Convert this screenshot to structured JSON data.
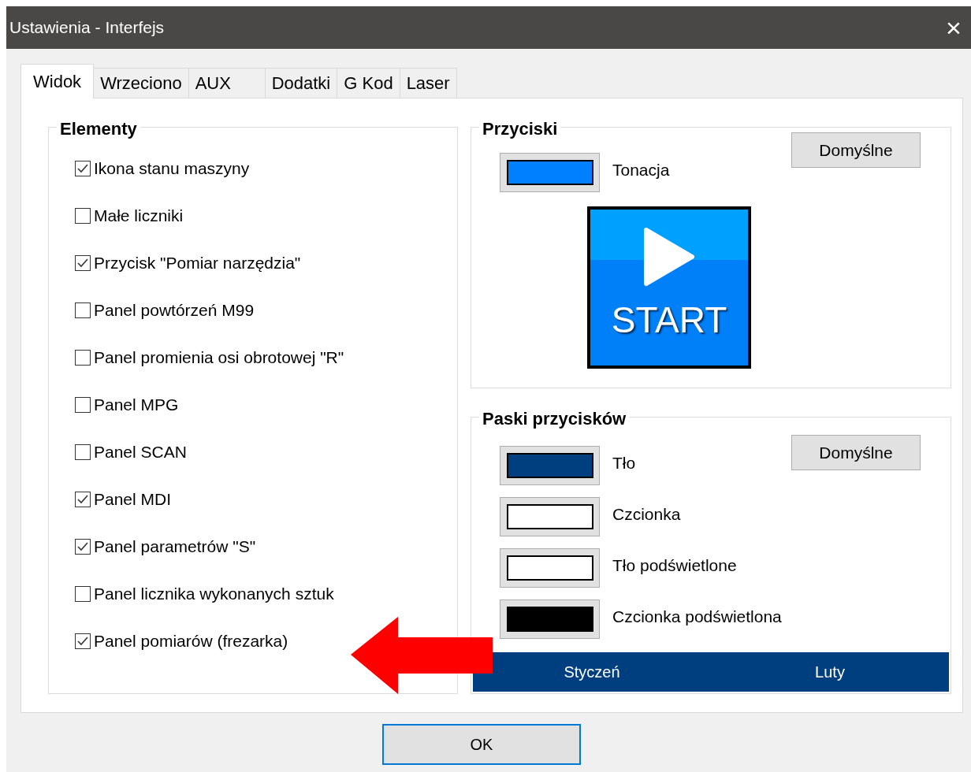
{
  "window": {
    "title": "Ustawienia - Interfejs",
    "close": "×"
  },
  "tabs": [
    {
      "label": "Widok",
      "selected": true
    },
    {
      "label": "Wrzeciono",
      "selected": false
    },
    {
      "label": "AUX",
      "selected": false
    },
    {
      "label": "Dodatki",
      "selected": false
    },
    {
      "label": "G Kod",
      "selected": false
    },
    {
      "label": "Laser",
      "selected": false
    }
  ],
  "elements": {
    "title": "Elementy",
    "items": [
      {
        "label": "Ikona stanu maszyny",
        "checked": true
      },
      {
        "label": "Małe liczniki",
        "checked": false
      },
      {
        "label": "Przycisk \"Pomiar narzędzia\"",
        "checked": true
      },
      {
        "label": "Panel powtórzeń M99",
        "checked": false
      },
      {
        "label": "Panel promienia osi obrotowej \"R\"",
        "checked": false
      },
      {
        "label": "Panel MPG",
        "checked": false
      },
      {
        "label": "Panel SCAN",
        "checked": false
      },
      {
        "label": "Panel MDI",
        "checked": true
      },
      {
        "label": "Panel parametrów \"S\"",
        "checked": true
      },
      {
        "label": "Panel licznika wykonanych sztuk",
        "checked": false
      },
      {
        "label": "Panel pomiarów (frezarka)",
        "checked": true
      }
    ]
  },
  "buttons_group": {
    "title": "Przyciski",
    "default_button": "Domyślne",
    "colors": [
      {
        "label": "Tonacja",
        "color": "#0080ff"
      }
    ],
    "preview": {
      "label": "START"
    }
  },
  "bars_group": {
    "title": "Paski przycisków",
    "default_button": "Domyślne",
    "colors": [
      {
        "label": "Tło",
        "color": "#003f7f"
      },
      {
        "label": "Czcionka",
        "color": "#ffffff"
      },
      {
        "label": "Tło podświetlone",
        "color": "#ffffff"
      },
      {
        "label": "Czcionka podświetlona",
        "color": "#000000"
      }
    ],
    "preview": [
      "Styczeń",
      "Luty"
    ]
  },
  "ok_button": "OK"
}
